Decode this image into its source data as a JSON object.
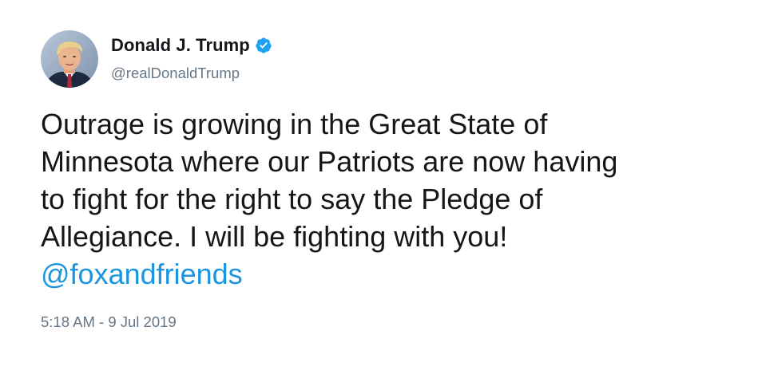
{
  "author": {
    "display_name": "Donald J. Trump",
    "handle": "@realDonaldTrump",
    "verified": true,
    "avatar_icon": "profile-photo"
  },
  "tweet": {
    "lines": [
      "Outrage is growing in the Great State of",
      "Minnesota where our Patriots are now having",
      "to fight for the right to say the Pledge of",
      "Allegiance. I will be fighting with you!"
    ],
    "mention": "@foxandfriends",
    "timestamp": "5:18 AM - 9 Jul 2019"
  },
  "colors": {
    "text": "#14171a",
    "secondary": "#657786",
    "link": "#1b95e0",
    "verified_badge": "#1da1f2",
    "background": "#ffffff"
  }
}
